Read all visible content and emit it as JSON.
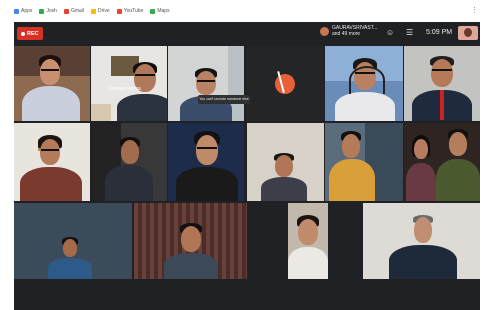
{
  "browser": {
    "bookmarks": [
      {
        "label": "Apps",
        "color": "#4285f4"
      },
      {
        "label": "Josh",
        "color": "#34a853"
      },
      {
        "label": "Gmail",
        "color": "#ea4335"
      },
      {
        "label": "Drive",
        "color": "#fbbc05"
      },
      {
        "label": "YouTube",
        "color": "#ea4335"
      },
      {
        "label": "Maps",
        "color": "#34a853"
      }
    ]
  },
  "meet": {
    "rec_label": "REC",
    "presenter": {
      "line1": "GAURAVSRIVAST...",
      "line2": "and 49 more"
    },
    "time": "5:09 PM",
    "pinned_name": "Chetna Verma",
    "caption": "You can't unmute someone else",
    "icons": [
      "people-icon",
      "chat-icon"
    ]
  }
}
